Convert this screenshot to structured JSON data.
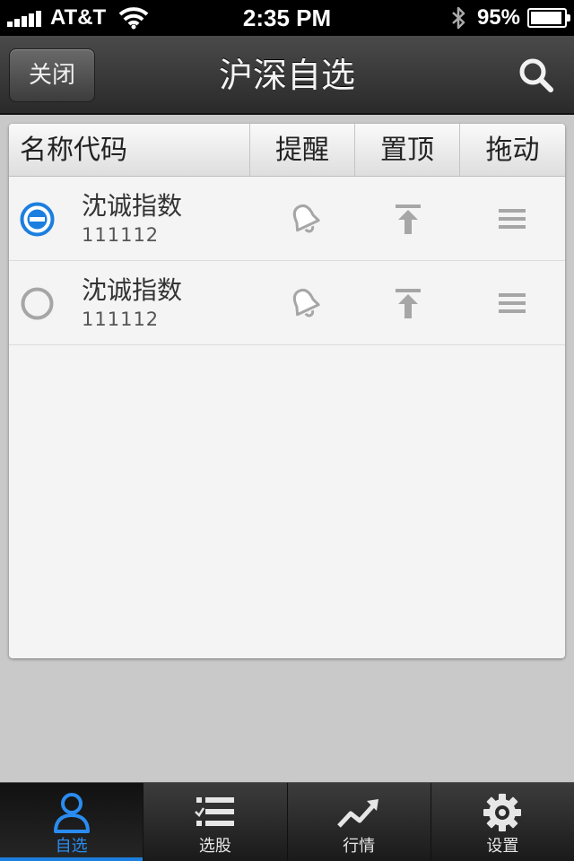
{
  "status_bar": {
    "carrier": "AT&T",
    "time": "2:35 PM",
    "battery": "95%",
    "battery_level": 0.95
  },
  "nav": {
    "close_label": "关闭",
    "title": "沪深自选"
  },
  "table": {
    "headers": {
      "name": "名称代码",
      "remind": "提醒",
      "top": "置顶",
      "drag": "拖动"
    },
    "rows": [
      {
        "name": "沈诚指数",
        "code": "111112",
        "delete_state": "active"
      },
      {
        "name": "沈诚指数",
        "code": "111112",
        "delete_state": "inactive"
      }
    ]
  },
  "tabs": [
    {
      "label": "自选",
      "icon": "person-icon",
      "active": true
    },
    {
      "label": "选股",
      "icon": "checklist-icon",
      "active": false
    },
    {
      "label": "行情",
      "icon": "trend-icon",
      "active": false
    },
    {
      "label": "设置",
      "icon": "gear-icon",
      "active": false
    }
  ],
  "colors": {
    "accent": "#1c7fdf",
    "inactive_icon": "#a6a6a6"
  }
}
